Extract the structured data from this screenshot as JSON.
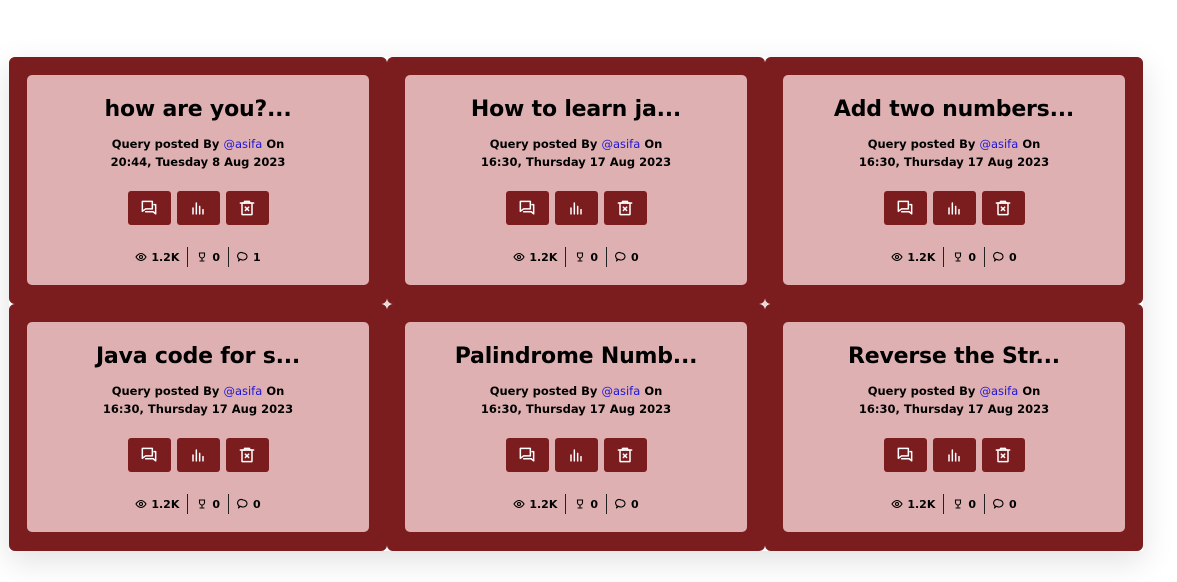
{
  "cards": [
    {
      "title": "how are you?...",
      "posted_prefix": "Query posted By",
      "author": "@asifa",
      "posted_suffix": "On",
      "timestamp": "20:44, Tuesday 8 Aug 2023",
      "views": "1.2K",
      "likes": "0",
      "comments": "1"
    },
    {
      "title": "How to learn ja...",
      "posted_prefix": "Query posted By",
      "author": "@asifa",
      "posted_suffix": "On",
      "timestamp": "16:30, Thursday 17 Aug 2023",
      "views": "1.2K",
      "likes": "0",
      "comments": "0"
    },
    {
      "title": "Add two numbers...",
      "posted_prefix": "Query posted By",
      "author": "@asifa",
      "posted_suffix": "On",
      "timestamp": "16:30, Thursday 17 Aug 2023",
      "views": "1.2K",
      "likes": "0",
      "comments": "0"
    },
    {
      "title": "Java code for s...",
      "posted_prefix": "Query posted By",
      "author": "@asifa",
      "posted_suffix": "On",
      "timestamp": "16:30, Thursday 17 Aug 2023",
      "views": "1.2K",
      "likes": "0",
      "comments": "0"
    },
    {
      "title": "Palindrome Numb...",
      "posted_prefix": "Query posted By",
      "author": "@asifa",
      "posted_suffix": "On",
      "timestamp": "16:30, Thursday 17 Aug 2023",
      "views": "1.2K",
      "likes": "0",
      "comments": "0"
    },
    {
      "title": "Reverse the Str...",
      "posted_prefix": "Query posted By",
      "author": "@asifa",
      "posted_suffix": "On",
      "timestamp": "16:30, Thursday 17 Aug 2023",
      "views": "1.2K",
      "likes": "0",
      "comments": "0"
    }
  ],
  "icons": {
    "action_buttons": [
      "chat-icon",
      "bar-chart-icon",
      "delete-icon"
    ],
    "stats": [
      "eye-icon",
      "trophy-icon",
      "comment-icon"
    ]
  },
  "colors": {
    "tile": "#7b1c1e",
    "card": "#deb0b1",
    "button": "#7b1c1e",
    "author_link": "#1f14d6"
  }
}
